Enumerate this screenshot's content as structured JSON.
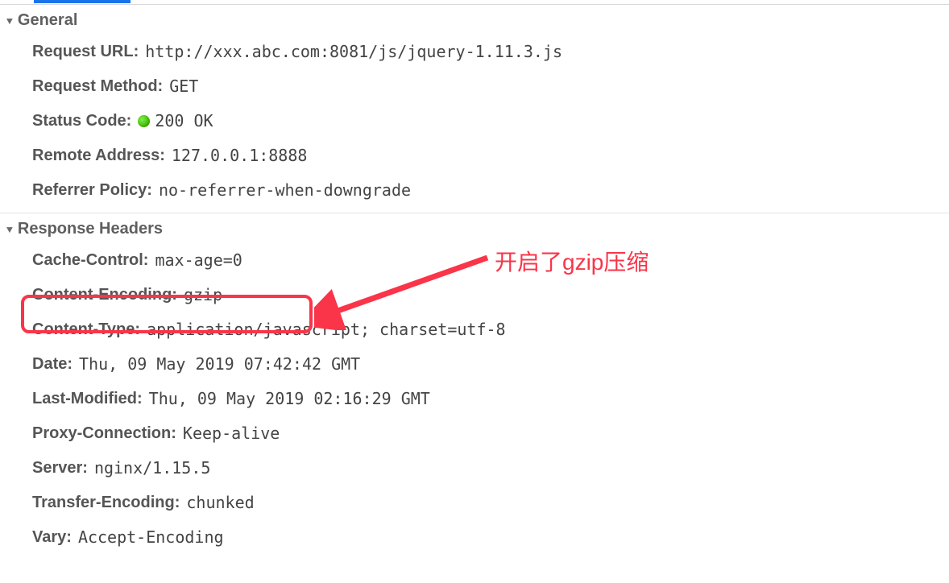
{
  "sections": {
    "general": {
      "title": "General",
      "request_url_label": "Request URL:",
      "request_url_value": "http://xxx.abc.com:8081/js/jquery-1.11.3.js",
      "request_method_label": "Request Method:",
      "request_method_value": "GET",
      "status_code_label": "Status Code:",
      "status_code_value": "200 OK",
      "remote_address_label": "Remote Address:",
      "remote_address_value": "127.0.0.1:8888",
      "referrer_policy_label": "Referrer Policy:",
      "referrer_policy_value": "no-referrer-when-downgrade"
    },
    "response_headers": {
      "title": "Response Headers",
      "cache_control_label": "Cache-Control:",
      "cache_control_value": "max-age=0",
      "content_encoding_label": "Content-Encoding:",
      "content_encoding_value": "gzip",
      "content_type_label": "Content-Type:",
      "content_type_value": "application/javascript; charset=utf-8",
      "date_label": "Date:",
      "date_value": "Thu, 09 May 2019 07:42:42 GMT",
      "last_modified_label": "Last-Modified:",
      "last_modified_value": "Thu, 09 May 2019 02:16:29 GMT",
      "proxy_connection_label": "Proxy-Connection:",
      "proxy_connection_value": "Keep-alive",
      "server_label": "Server:",
      "server_value": "nginx/1.15.5",
      "transfer_encoding_label": "Transfer-Encoding:",
      "transfer_encoding_value": "chunked",
      "vary_label": "Vary:",
      "vary_value": "Accept-Encoding"
    }
  },
  "annotation": {
    "text": "开启了gzip压缩",
    "color": "#fa3449"
  }
}
